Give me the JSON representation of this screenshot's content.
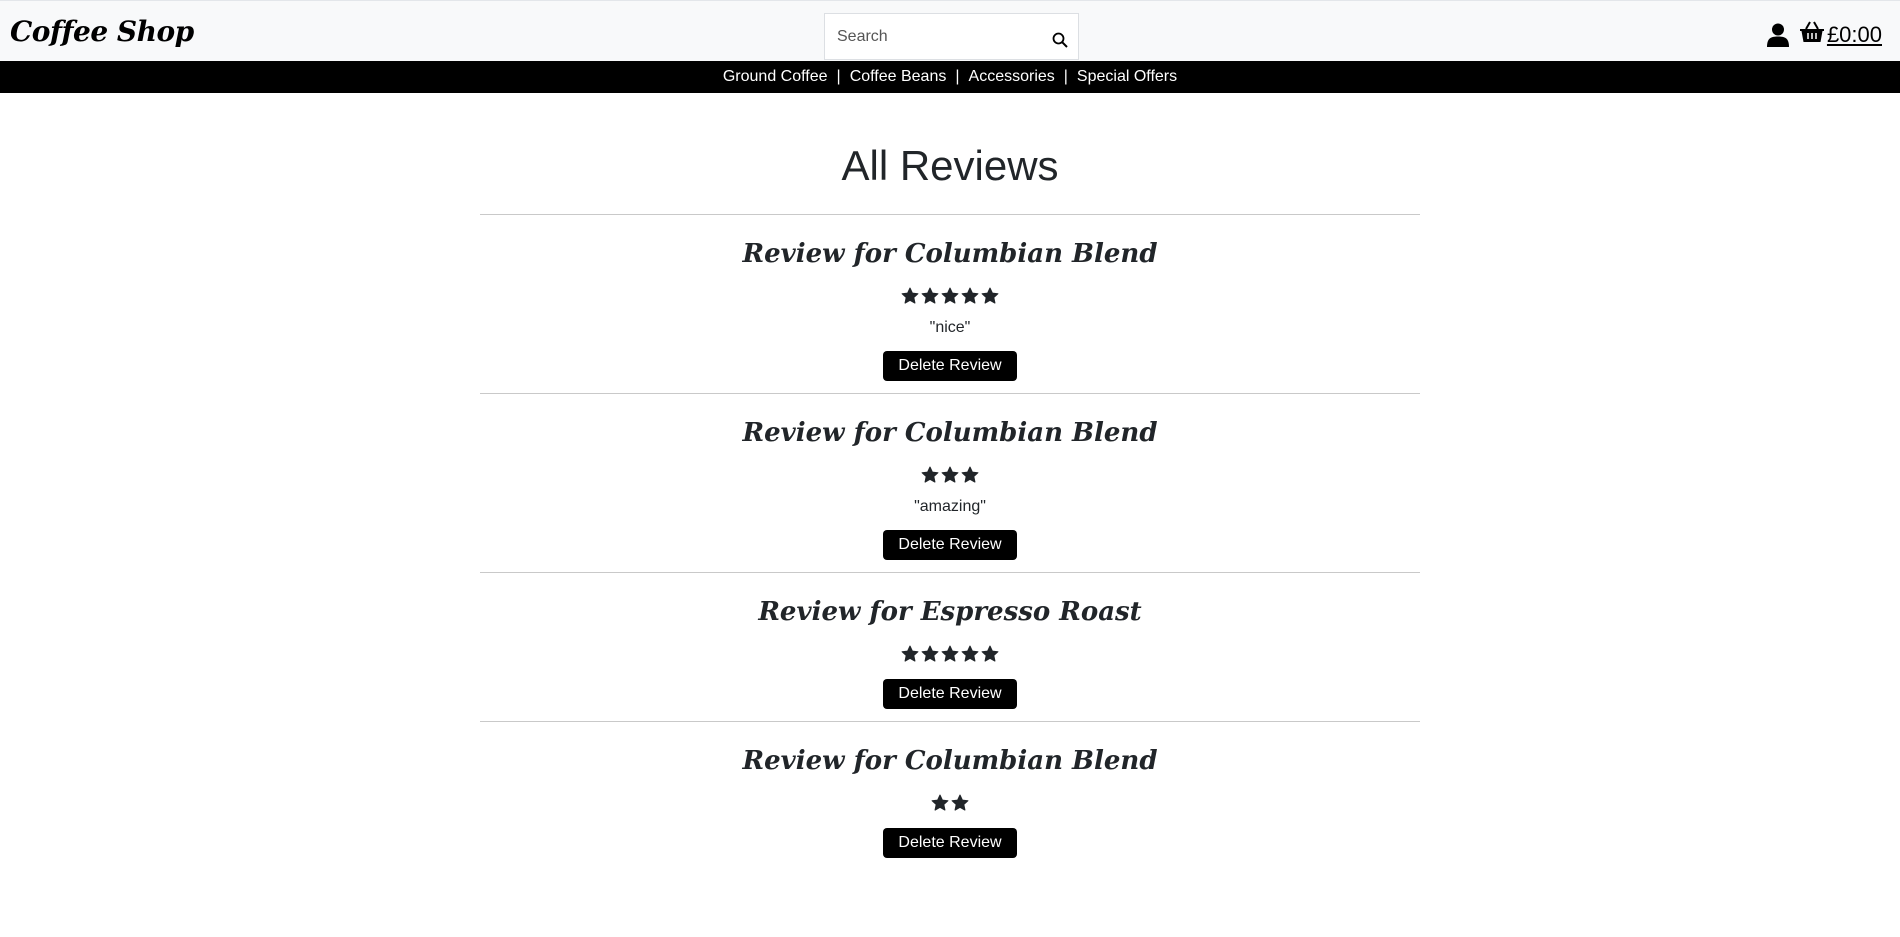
{
  "header": {
    "logo": "Coffee Shop",
    "search_placeholder": "Search",
    "search_icon": "search-icon",
    "account_icon": "user-icon",
    "cart_icon": "basket-icon",
    "cart_total": "£0:00"
  },
  "nav": {
    "items": [
      "Ground Coffee",
      "Coffee Beans",
      "Accessories",
      "Special Offers"
    ],
    "separator": "|"
  },
  "page": {
    "title": "All Reviews"
  },
  "reviews": [
    {
      "title": "Review for Columbian Blend",
      "rating": 5,
      "comment": "\"nice\"",
      "delete_label": "Delete Review"
    },
    {
      "title": "Review for Columbian Blend",
      "rating": 3,
      "comment": "\"amazing\"",
      "delete_label": "Delete Review"
    },
    {
      "title": "Review for Espresso Roast",
      "rating": 5,
      "comment": "",
      "delete_label": "Delete Review"
    },
    {
      "title": "Review for Columbian Blend",
      "rating": 2,
      "comment": "",
      "delete_label": "Delete Review"
    }
  ],
  "colors": {
    "topbar_bg": "#f8f9fa",
    "navbar_bg": "#000000",
    "text": "#212529",
    "button_bg": "#000000"
  }
}
